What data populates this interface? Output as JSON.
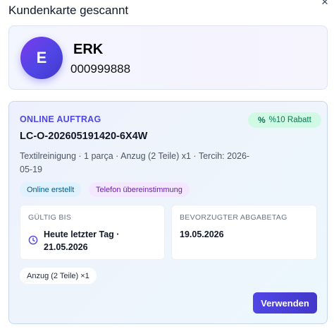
{
  "modal": {
    "title": "Kundenkarte gescannt",
    "close_label": "×"
  },
  "customer": {
    "avatar_letter": "E",
    "name": "ERK",
    "number": "000999888"
  },
  "order": {
    "label": "ONLINE AUFTRAG",
    "discount_icon": "%",
    "discount_label": "%10 Rabatt",
    "id": "LC-O-202605191420-6X4W",
    "description": "Textilreinigung · 1 parça · Anzug (2 Teile) x1 · Tercih: 2026-05-19",
    "tags": [
      {
        "label": "Online erstellt",
        "color": "#075985"
      },
      {
        "label": "Telefon übereinstimmung",
        "color": "#6b21a8"
      }
    ],
    "valid_until": {
      "label": "GÜLTIG BIS",
      "icon": "clock-icon",
      "value": "Heute letzter Tag · 21.05.2026"
    },
    "preferred_pickup": {
      "label": "BEVORZUGTER ABGABETAG",
      "value": "19.05.2026"
    },
    "item_chip": "Anzug (2 Teile) ×1",
    "use_button": "Verwenden"
  },
  "colors": {
    "accent": "#4f46e5",
    "discount_bg": "#d1fae5",
    "discount_text": "#047857"
  }
}
